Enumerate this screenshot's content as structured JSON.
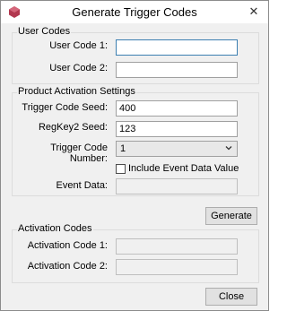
{
  "window": {
    "title": "Generate Trigger Codes",
    "close_glyph": "✕"
  },
  "user_codes": {
    "group_title": "User Codes",
    "user_code_1_label": "User Code 1:",
    "user_code_1_value": "",
    "user_code_2_label": "User Code 2:",
    "user_code_2_value": ""
  },
  "product_activation": {
    "group_title": "Product Activation Settings",
    "trigger_code_seed_label": "Trigger Code Seed:",
    "trigger_code_seed_value": "400",
    "regkey2_seed_label": "RegKey2 Seed:",
    "regkey2_seed_value": "123",
    "trigger_code_number_label": "Trigger Code Number:",
    "trigger_code_number_value": "1",
    "include_event_data_label": "Include Event Data Value",
    "include_event_data_checked": false,
    "event_data_label": "Event Data:",
    "event_data_value": ""
  },
  "generate_button": "Generate",
  "activation_codes": {
    "group_title": "Activation Codes",
    "activation_code_1_label": "Activation Code 1:",
    "activation_code_1_value": "",
    "activation_code_2_label": "Activation Code 2:",
    "activation_code_2_value": ""
  },
  "close_button": "Close",
  "icons": {
    "app_icon": "app-logo-icon",
    "dropdown": "chevron-down-icon",
    "close": "close-icon"
  },
  "colors": {
    "window_bg": "#f0f0f0",
    "titlebar_bg": "#ffffff",
    "focus_border": "#3c7fb1",
    "app_icon": "#b2384f"
  }
}
